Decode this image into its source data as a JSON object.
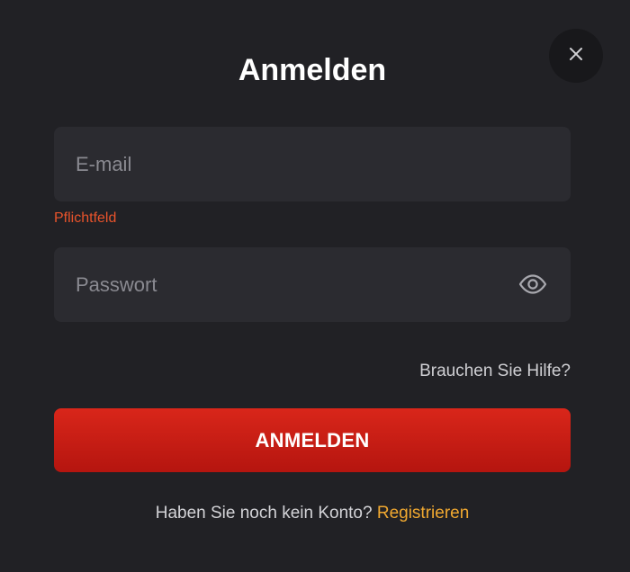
{
  "dialog": {
    "title": "Anmelden",
    "close_icon": "close-icon"
  },
  "form": {
    "email": {
      "placeholder": "E-mail",
      "value": "",
      "error": "Pflichtfeld"
    },
    "password": {
      "placeholder": "Passwort",
      "value": "",
      "toggle_icon": "eye-icon"
    },
    "help_link": "Brauchen Sie Hilfe?",
    "submit_label": "ANMELDEN"
  },
  "footer": {
    "prompt": "Haben Sie noch kein Konto?",
    "register_link": "Registrieren"
  },
  "colors": {
    "background": "#212125",
    "field": "#2b2b30",
    "error": "#e8532b",
    "primary": "#d9261a",
    "link_accent": "#f0a830"
  }
}
